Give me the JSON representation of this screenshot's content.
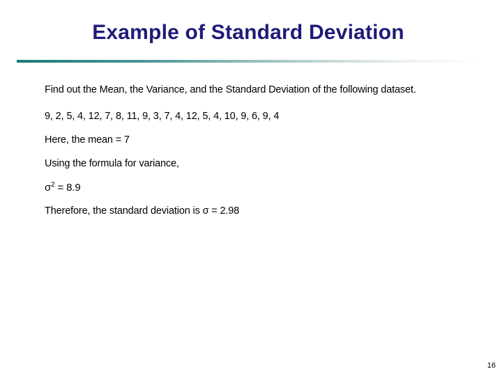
{
  "slide": {
    "title": "Example of Standard Deviation",
    "page_number": "16",
    "accent_color": "#1f7a7a",
    "title_color": "#1f1b78",
    "background_color": "#ffffff",
    "body": {
      "prompt": "Find out the Mean, the Variance, and the Standard Deviation of the following dataset.",
      "dataset": "9, 2, 5, 4, 12, 7, 8, 11, 9, 3, 7, 4, 12, 5, 4, 10, 9, 6, 9, 4",
      "mean_line": "Here, the mean = 7",
      "formula_intro": "Using the formula for variance,",
      "variance_symbol": "σ",
      "variance_exponent": "2",
      "variance_value": " = 8.9",
      "conclusion": "Therefore, the standard deviation is σ  = 2.98"
    }
  },
  "chart_data": {
    "type": "table",
    "title": "Example of Standard Deviation",
    "categories": [
      "9",
      "2",
      "5",
      "4",
      "12",
      "7",
      "8",
      "11",
      "9",
      "3",
      "7",
      "4",
      "12",
      "5",
      "4",
      "10",
      "9",
      "6",
      "9",
      "4"
    ],
    "values": [
      9,
      2,
      5,
      4,
      12,
      7,
      8,
      11,
      9,
      3,
      7,
      4,
      12,
      5,
      4,
      10,
      9,
      6,
      9,
      4
    ],
    "statistics": {
      "mean": 7,
      "variance": 8.9,
      "standard_deviation": 2.98,
      "count": 20
    },
    "xlabel": "",
    "ylabel": ""
  }
}
